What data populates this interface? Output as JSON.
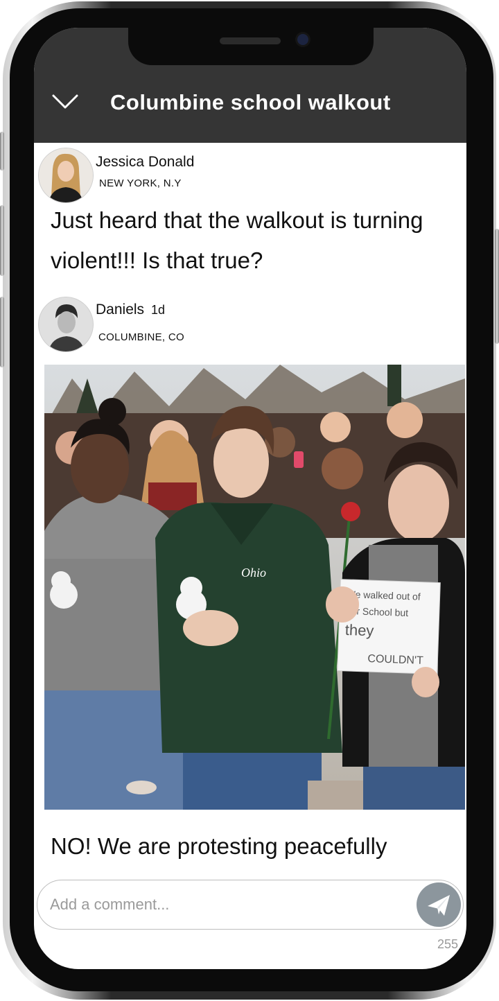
{
  "header": {
    "title": "Columbine school walkout",
    "back_icon": "chevron-down-icon"
  },
  "posts": [
    {
      "author": "Jessica Donald",
      "location": "NEW YORK, N.Y",
      "text": "Just heard that the  walkout is turning violent!!! Is that true?"
    },
    {
      "author": "Daniels",
      "age": "1d",
      "location": "COLUMBINE, CO",
      "image_sign_text": "We walked out of our School but they COULDN'T"
    }
  ],
  "reply": {
    "text": "NO! We are protesting peacefully"
  },
  "comment": {
    "placeholder": "Add a comment...",
    "value": "",
    "char_count": "255",
    "send_icon": "paper-plane-icon"
  },
  "colors": {
    "header_bg": "#353535",
    "send_button": "#8c969d",
    "jacket_green": "#24412f"
  }
}
